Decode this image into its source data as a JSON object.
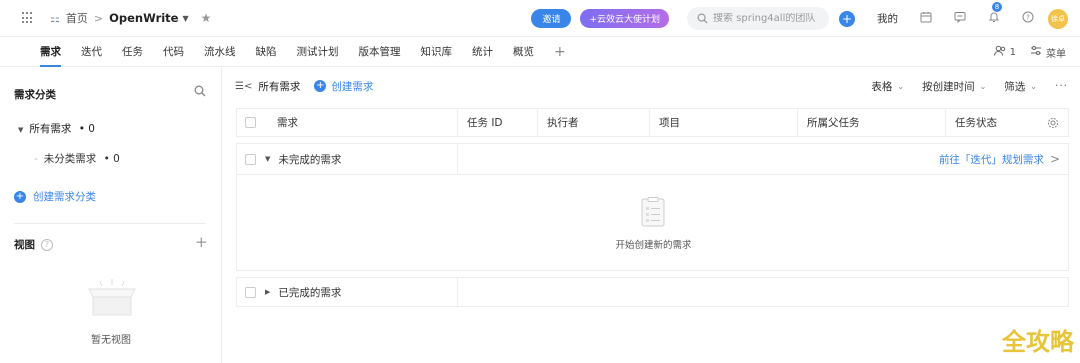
{
  "header": {
    "breadcrumb_home": "首页",
    "breadcrumb_sep": ">",
    "project": "OpenWrite",
    "invite_label": "邀请",
    "promo_label": "+云效云大使计划",
    "search_placeholder": "搜索 spring4all的团队",
    "mine_label": "我的",
    "notif_count": "8",
    "avatar_text": "徐卓",
    "colors": {
      "accent": "#3a86e8",
      "promo_start": "#7d6ef0",
      "promo_end": "#b46de8",
      "avatar": "#f1c34a"
    }
  },
  "tabs": [
    {
      "label": "需求",
      "active": true
    },
    {
      "label": "迭代"
    },
    {
      "label": "任务"
    },
    {
      "label": "代码"
    },
    {
      "label": "流水线"
    },
    {
      "label": "缺陷"
    },
    {
      "label": "测试计划"
    },
    {
      "label": "版本管理"
    },
    {
      "label": "知识库"
    },
    {
      "label": "统计"
    },
    {
      "label": "概览"
    }
  ],
  "tab_right": {
    "members_count": "1",
    "menu_label": "菜单"
  },
  "sidebar": {
    "title": "需求分类",
    "all_label": "所有需求",
    "all_count": "• 0",
    "uncat_label": "未分类需求",
    "uncat_count": "• 0",
    "create_label": "创建需求分类",
    "view_title": "视图",
    "empty_view": "暂无视图"
  },
  "toolbar": {
    "all_label": "所有需求",
    "create_label": "创建需求",
    "table_label": "表格",
    "sort_label": "按创建时间",
    "filter_label": "筛选",
    "more": "···"
  },
  "table": {
    "columns": [
      "需求",
      "任务 ID",
      "执行者",
      "项目",
      "所属父任务",
      "任务状态"
    ]
  },
  "groups": {
    "incomplete_label": "未完成的需求",
    "plan_link": "前往「迭代」规划需求",
    "empty_text": "开始创建新的需求",
    "complete_label": "已完成的需求"
  },
  "watermark": "全攻略"
}
